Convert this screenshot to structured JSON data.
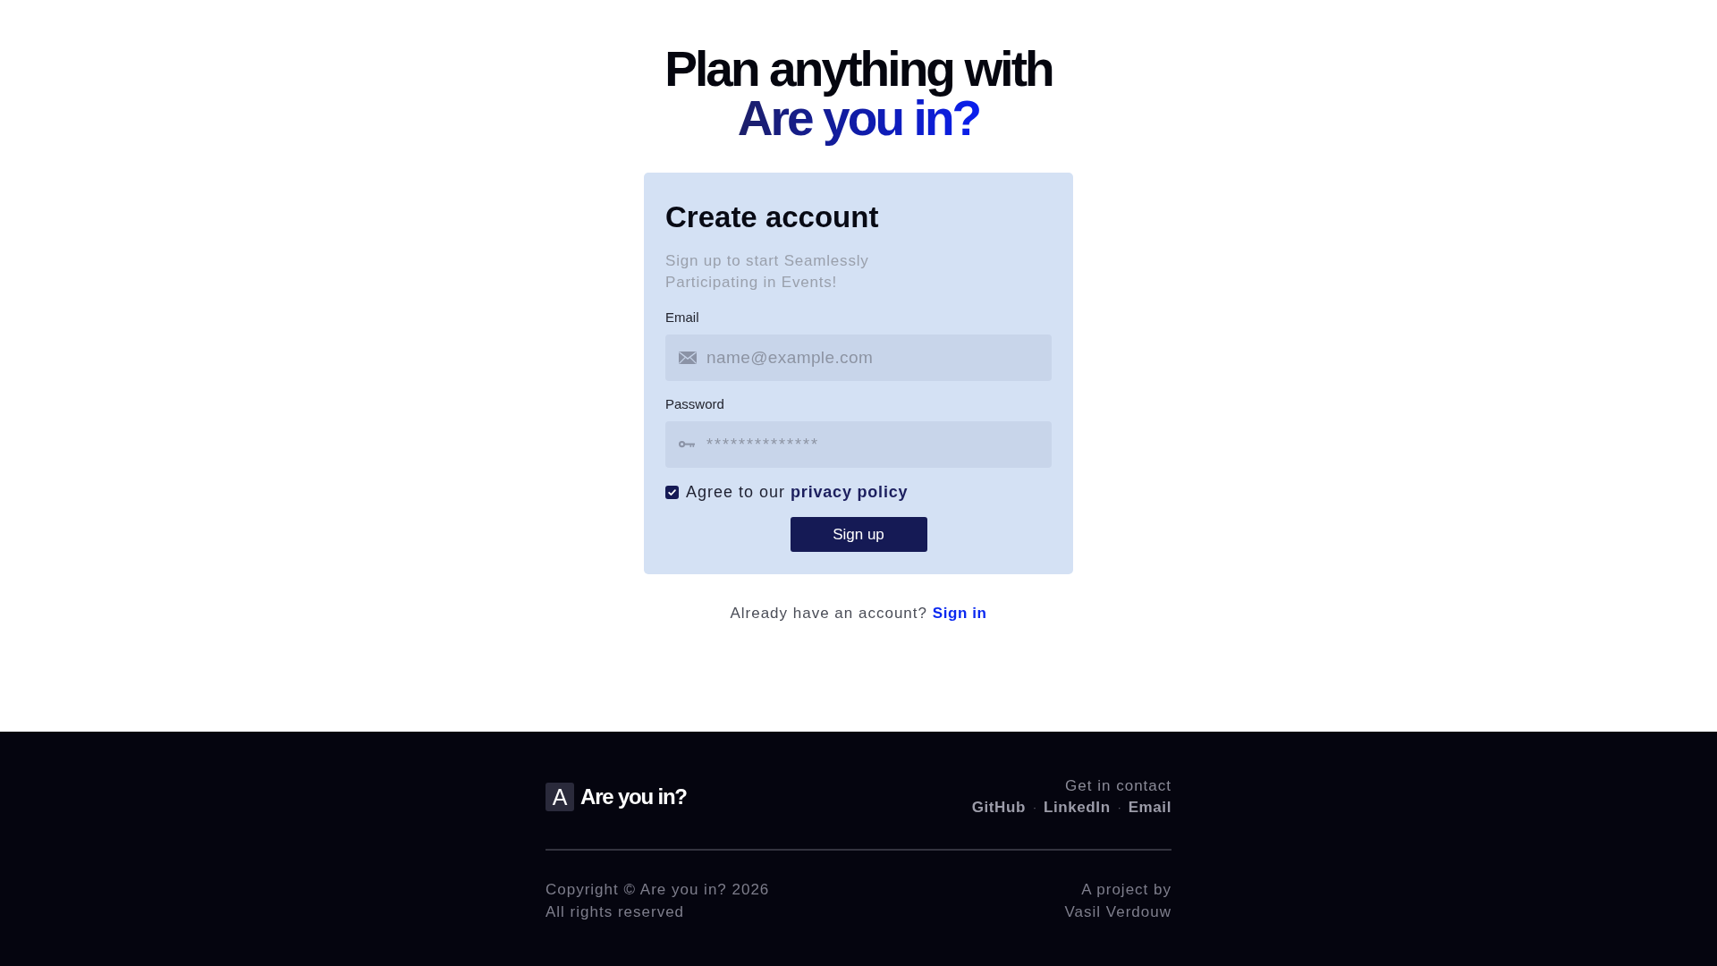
{
  "hero": {
    "line_1": "Plan anything with",
    "line_2": "Are you in?"
  },
  "signup_card": {
    "title": "Create account",
    "subtitle": "Sign up to start Seamlessly Participating in Events!",
    "fields": [
      {
        "kind": "email",
        "label": "Email",
        "placeholder": "name@example.com"
      },
      {
        "kind": "password",
        "label": "Password",
        "placeholder": "**************"
      }
    ],
    "agreement": {
      "checked": true,
      "text": "Agree to our",
      "link": "privacy policy"
    },
    "submit_button": "Sign up"
  },
  "signin_prompt": {
    "text": "Already have an account?",
    "link": "Sign in"
  },
  "footer": {
    "brand": {
      "mark": "A",
      "name": "Are you in?"
    },
    "contact": {
      "heading": "Get in contact",
      "items": [
        {
          "kind": "link",
          "label": "GitHub"
        },
        {
          "kind": "separator",
          "label": "·"
        },
        {
          "kind": "link",
          "label": "LinkedIn"
        },
        {
          "kind": "separator",
          "label": "·"
        },
        {
          "kind": "link",
          "label": "Email"
        }
      ]
    },
    "copyright": [
      "Copyright © Are you in? 2026",
      "All rights reserved"
    ],
    "credit": [
      "A project by",
      "Vasil Verdouw"
    ]
  }
}
